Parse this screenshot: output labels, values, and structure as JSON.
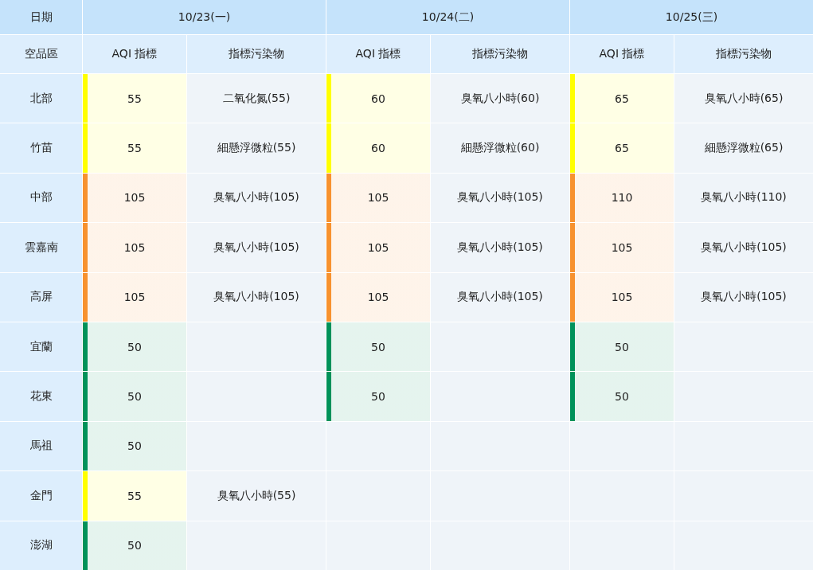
{
  "header": {
    "date_label": "日期",
    "region_label": "空品區",
    "days": [
      {
        "date": "10/23(一)",
        "columns": [
          "AQI 指標",
          "指標污染物"
        ]
      },
      {
        "date": "10/24(二)",
        "columns": [
          "AQI 指標",
          "指標污染物"
        ]
      },
      {
        "date": "10/25(三)",
        "columns": [
          "AQI 指標",
          "指標污染物"
        ]
      }
    ]
  },
  "rows": [
    {
      "region": "北部",
      "forecasts": [
        {
          "aqi": "55",
          "pollutant": "二氧化氮(55)",
          "color": "#ffff00"
        },
        {
          "aqi": "60",
          "pollutant": "臭氧八小時(60)",
          "color": "#ffff00"
        },
        {
          "aqi": "65",
          "pollutant": "臭氧八小時(65)",
          "color": "#ffff00"
        }
      ]
    },
    {
      "region": "竹苗",
      "forecasts": [
        {
          "aqi": "55",
          "pollutant": "細懸浮微粒(55)",
          "color": "#ffff00"
        },
        {
          "aqi": "60",
          "pollutant": "細懸浮微粒(60)",
          "color": "#ffff00"
        },
        {
          "aqi": "65",
          "pollutant": "細懸浮微粒(65)",
          "color": "#ffff00"
        }
      ]
    },
    {
      "region": "中部",
      "forecasts": [
        {
          "aqi": "105",
          "pollutant": "臭氧八小時(105)",
          "color": "#f7922f"
        },
        {
          "aqi": "105",
          "pollutant": "臭氧八小時(105)",
          "color": "#f7922f"
        },
        {
          "aqi": "110",
          "pollutant": "臭氧八小時(110)",
          "color": "#f7922f"
        }
      ]
    },
    {
      "region": "雲嘉南",
      "forecasts": [
        {
          "aqi": "105",
          "pollutant": "臭氧八小時(105)",
          "color": "#f7922f"
        },
        {
          "aqi": "105",
          "pollutant": "臭氧八小時(105)",
          "color": "#f7922f"
        },
        {
          "aqi": "105",
          "pollutant": "臭氧八小時(105)",
          "color": "#f7922f"
        }
      ]
    },
    {
      "region": "高屏",
      "forecasts": [
        {
          "aqi": "105",
          "pollutant": "臭氧八小時(105)",
          "color": "#f7922f"
        },
        {
          "aqi": "105",
          "pollutant": "臭氧八小時(105)",
          "color": "#f7922f"
        },
        {
          "aqi": "105",
          "pollutant": "臭氧八小時(105)",
          "color": "#f7922f"
        }
      ]
    },
    {
      "region": "宜蘭",
      "forecasts": [
        {
          "aqi": "50",
          "color": "#00925a"
        },
        {
          "aqi": "50",
          "color": "#00925a"
        },
        {
          "aqi": "50",
          "color": "#00925a"
        }
      ]
    },
    {
      "region": "花東",
      "forecasts": [
        {
          "aqi": "50",
          "color": "#00925a"
        },
        {
          "aqi": "50",
          "color": "#00925a"
        },
        {
          "aqi": "50",
          "color": "#00925a"
        }
      ]
    },
    {
      "region": "馬祖",
      "forecasts": [
        {
          "aqi": "50",
          "color": "#00925a"
        }
      ]
    },
    {
      "region": "金門",
      "forecasts": [
        {
          "aqi": "55",
          "pollutant": "臭氧八小時(55)",
          "color": "#ffff00"
        }
      ]
    },
    {
      "region": "澎湖",
      "forecasts": [
        {
          "aqi": "50",
          "color": "#00925a"
        }
      ]
    }
  ]
}
